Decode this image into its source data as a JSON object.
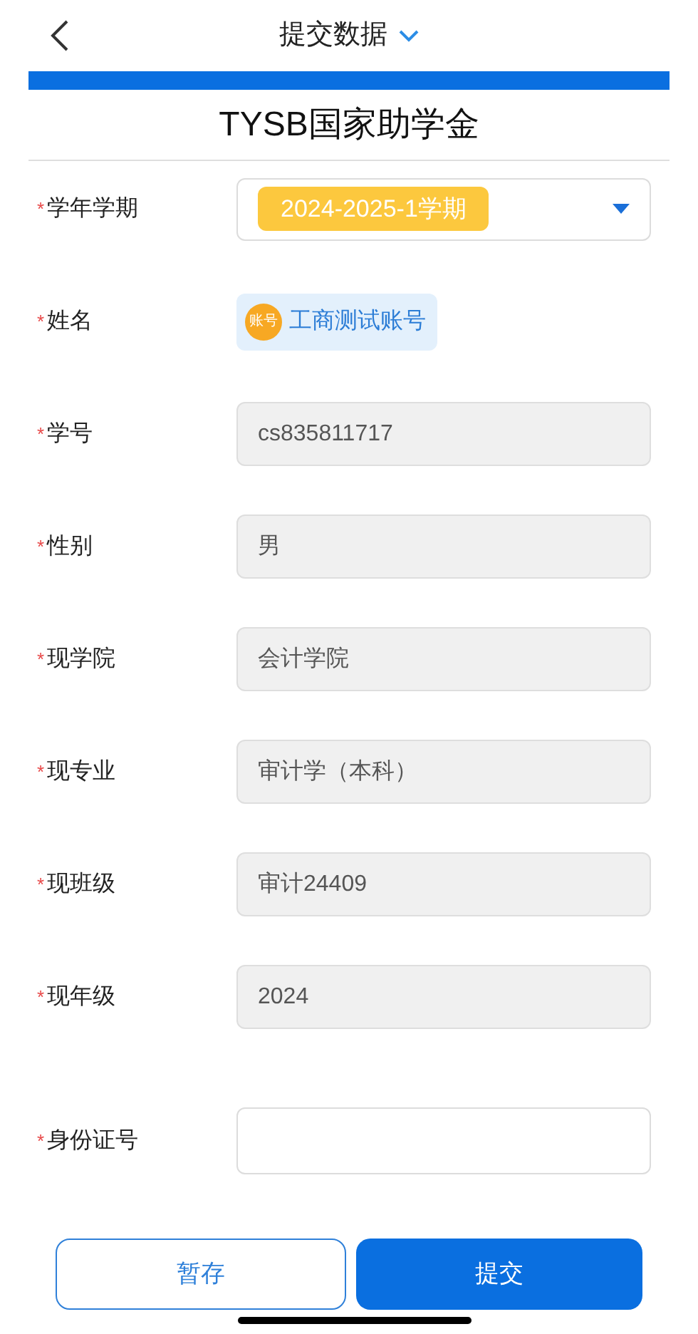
{
  "header": {
    "title": "提交数据"
  },
  "form_title": "TYSB国家助学金",
  "fields": [
    {
      "kind": "select",
      "label": "学年学期",
      "required_mark": "*",
      "value": "2024-2025-1学期"
    },
    {
      "kind": "user",
      "label": "姓名",
      "required_mark": "*",
      "avatar": "账号",
      "value": "工商测试账号"
    },
    {
      "kind": "readonly",
      "label": "学号",
      "required_mark": "*",
      "value": "cs835811717"
    },
    {
      "kind": "readonly",
      "label": "性别",
      "required_mark": "*",
      "value": "男"
    },
    {
      "kind": "readonly",
      "label": "现学院",
      "required_mark": "*",
      "value": "会计学院"
    },
    {
      "kind": "readonly",
      "label": "现专业",
      "required_mark": "*",
      "value": "审计学（本科）"
    },
    {
      "kind": "readonly",
      "label": "现班级",
      "required_mark": "*",
      "value": "审计24409"
    },
    {
      "kind": "readonly",
      "label": "现年级",
      "required_mark": "*",
      "value": "2024"
    },
    {
      "kind": "input",
      "label": "身份证号",
      "required_mark": "*"
    }
  ],
  "buttons": {
    "save": "暂存",
    "submit": "提交"
  }
}
